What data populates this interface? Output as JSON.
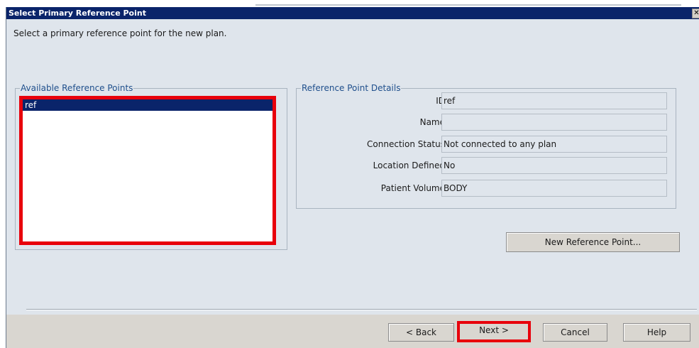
{
  "window": {
    "title": "Select Primary Reference Point",
    "close_glyph": "✕"
  },
  "instruction": "Select a primary reference point for the new plan.",
  "available": {
    "legend": "Available Reference Points",
    "items": [
      "ref"
    ]
  },
  "details": {
    "legend": "Reference Point Details",
    "fields": [
      {
        "label": "ID",
        "value": "ref"
      },
      {
        "label": "Name",
        "value": ""
      },
      {
        "label": "Connection Status",
        "value": "Not connected to any plan"
      },
      {
        "label": "Location Defined",
        "value": "No"
      },
      {
        "label": "Patient Volume",
        "value": "BODY"
      }
    ]
  },
  "buttons": {
    "new_reference_point": "New Reference Point...",
    "back": "< Back",
    "next": "Next >",
    "cancel": "Cancel",
    "help": "Help"
  },
  "colors": {
    "titlebar": "#0a246a",
    "highlight": "#e8000b",
    "dialog_bg": "#dfe5ec"
  }
}
